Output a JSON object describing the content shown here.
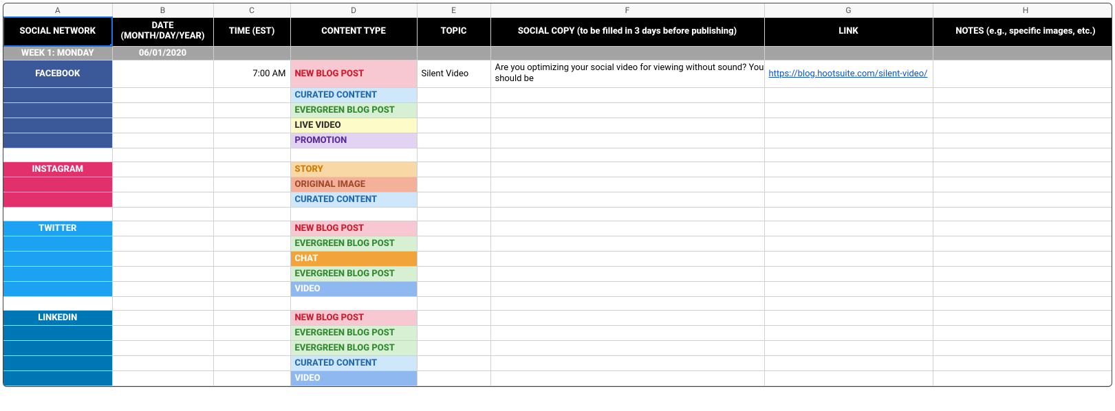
{
  "columns": [
    "A",
    "B",
    "C",
    "D",
    "E",
    "F",
    "G",
    "H"
  ],
  "headers": {
    "A": "SOCIAL NETWORK",
    "B_line1": "DATE",
    "B_line2": "(MONTH/DAY/YEAR)",
    "C": "TIME (EST)",
    "D": "CONTENT TYPE",
    "E": "TOPIC",
    "F": "SOCIAL COPY (to be filled in 3 days before publishing)",
    "G": "LINK",
    "H": "NOTES (e.g., specific images, etc.)"
  },
  "week": {
    "label": "WEEK 1: MONDAY",
    "date": "06/01/2020"
  },
  "networks": {
    "facebook": "FACEBOOK",
    "instagram": "INSTAGRAM",
    "twitter": "TWITTER",
    "linkedin": "LINKEDIN"
  },
  "content_types": {
    "newblog": "NEW BLOG POST",
    "curated": "CURATED CONTENT",
    "evergreen": "EVERGREEN BLOG POST",
    "live": "LIVE VIDEO",
    "promo": "PROMOTION",
    "story": "STORY",
    "origimg": "ORIGINAL IMAGE",
    "chat": "CHAT",
    "video": "VIDEO"
  },
  "rows": {
    "fb1": {
      "time": "7:00 AM",
      "topic": "Silent Video",
      "copy": "Are you optimizing your social video for viewing without sound? You should be",
      "link": "https://blog.hootsuite.com/silent-video/"
    }
  }
}
